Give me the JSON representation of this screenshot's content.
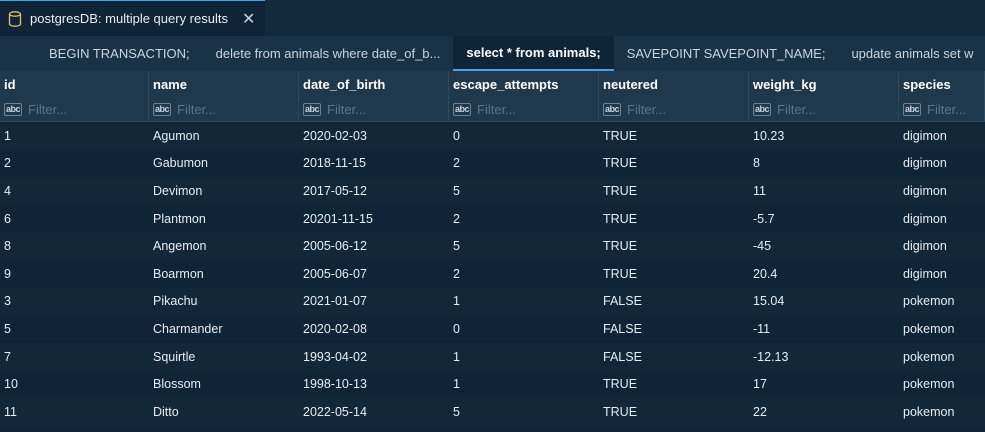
{
  "editor_tab": {
    "title": "postgresDB: multiple query results"
  },
  "query_tabs": [
    {
      "label": "BEGIN TRANSACTION;"
    },
    {
      "label": "delete from animals where date_of_b..."
    },
    {
      "label": "select * from animals;"
    },
    {
      "label": "SAVEPOINT SAVEPOINT_NAME;"
    },
    {
      "label": "update animals set w"
    }
  ],
  "active_tab_index": 2,
  "grid": {
    "columns": [
      "id",
      "name",
      "date_of_birth",
      "escape_attempts",
      "neutered",
      "weight_kg",
      "species"
    ],
    "filter_placeholder": "Filter...",
    "filter_icon": "abc-icon",
    "rows": [
      [
        "1",
        "Agumon",
        "2020-02-03",
        "0",
        "TRUE",
        "10.23",
        "digimon"
      ],
      [
        "2",
        "Gabumon",
        "2018-11-15",
        "2",
        "TRUE",
        "8",
        "digimon"
      ],
      [
        "4",
        "Devimon",
        "2017-05-12",
        "5",
        "TRUE",
        "11",
        "digimon"
      ],
      [
        "6",
        "Plantmon",
        "20201-11-15",
        "2",
        "TRUE",
        "-5.7",
        "digimon"
      ],
      [
        "8",
        "Angemon",
        "2005-06-12",
        "5",
        "TRUE",
        "-45",
        "digimon"
      ],
      [
        "9",
        "Boarmon",
        "2005-06-07",
        "2",
        "TRUE",
        "20.4",
        "digimon"
      ],
      [
        "3",
        "Pikachu",
        "2021-01-07",
        "1",
        "FALSE",
        "15.04",
        "pokemon"
      ],
      [
        "5",
        "Charmander",
        "2020-02-08",
        "0",
        "FALSE",
        "-11",
        "pokemon"
      ],
      [
        "7",
        "Squirtle",
        "1993-04-02",
        "1",
        "FALSE",
        "-12.13",
        "pokemon"
      ],
      [
        "10",
        "Blossom",
        "1998-10-13",
        "1",
        "TRUE",
        "17",
        "pokemon"
      ],
      [
        "11",
        "Ditto",
        "2022-05-14",
        "5",
        "TRUE",
        "22",
        "pokemon"
      ]
    ]
  }
}
